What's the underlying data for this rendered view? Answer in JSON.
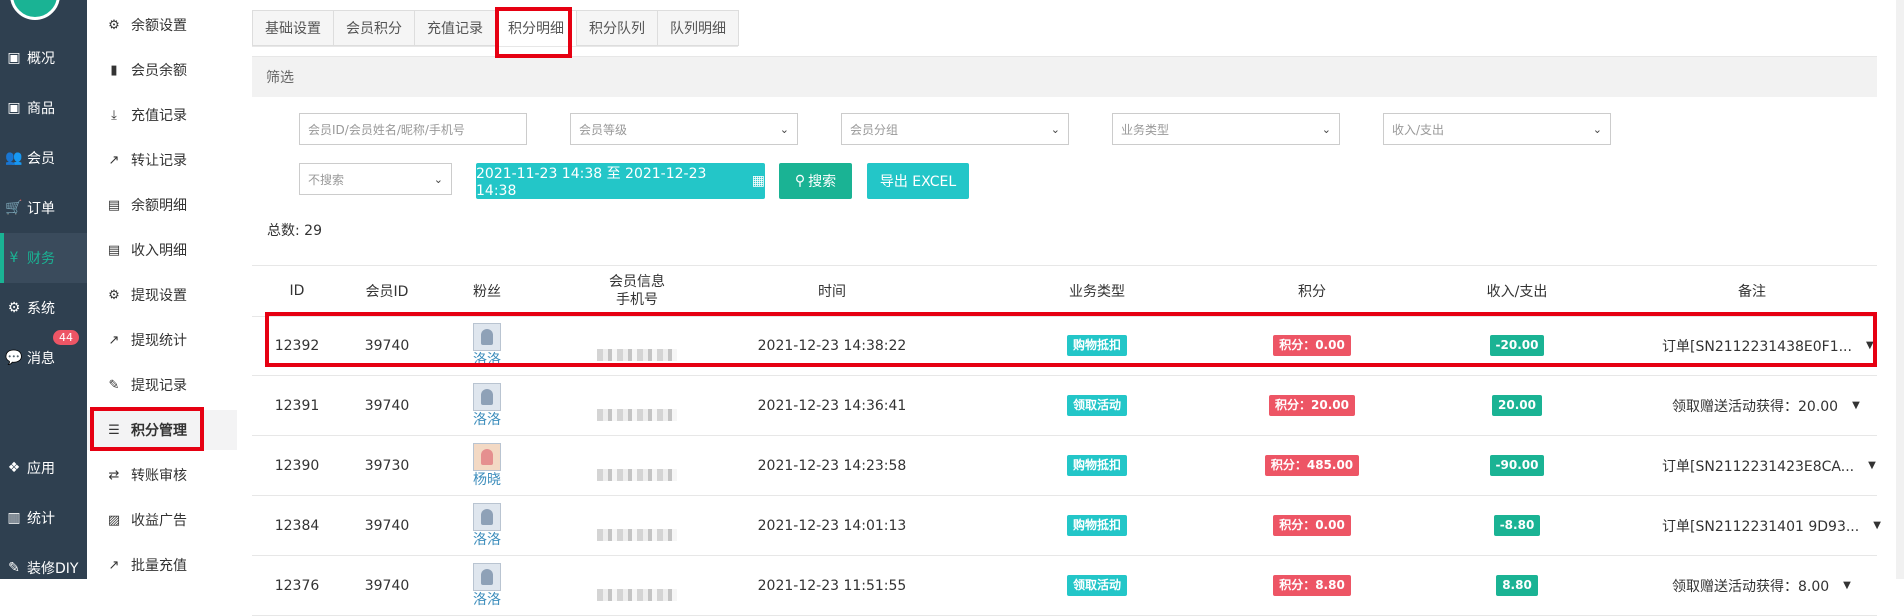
{
  "nav": {
    "items": [
      {
        "label": "概况",
        "icon": "dashboard-icon",
        "glyph": "▣"
      },
      {
        "label": "商品",
        "icon": "goods-icon",
        "glyph": "▣"
      },
      {
        "label": "会员",
        "icon": "users-icon",
        "glyph": "👥"
      },
      {
        "label": "订单",
        "icon": "cart-icon",
        "glyph": "🛒"
      },
      {
        "label": "财务",
        "icon": "yen-icon",
        "glyph": "¥"
      },
      {
        "label": "系统",
        "icon": "gears-icon",
        "glyph": "⚙"
      },
      {
        "label": "消息",
        "icon": "chat-icon",
        "glyph": "💬"
      },
      {
        "label": "应用",
        "icon": "apps-icon",
        "glyph": "❖"
      },
      {
        "label": "统计",
        "icon": "bar-chart-icon",
        "glyph": "▥"
      },
      {
        "label": "装修DIY",
        "icon": "brush-icon",
        "glyph": "✎"
      }
    ],
    "badge": "44"
  },
  "subnav": {
    "items": [
      {
        "label": "余额设置",
        "glyph": "⚙"
      },
      {
        "label": "会员余额",
        "glyph": "▮"
      },
      {
        "label": "充值记录",
        "glyph": "⤓"
      },
      {
        "label": "转让记录",
        "glyph": "↗"
      },
      {
        "label": "余额明细",
        "glyph": "▤"
      },
      {
        "label": "收入明细",
        "glyph": "▤"
      },
      {
        "label": "提现设置",
        "glyph": "⚙"
      },
      {
        "label": "提现统计",
        "glyph": "↗"
      },
      {
        "label": "提现记录",
        "glyph": "✎"
      },
      {
        "label": "积分管理",
        "glyph": "☰"
      },
      {
        "label": "转账审核",
        "glyph": "⇄"
      },
      {
        "label": "收益广告",
        "glyph": "▨"
      },
      {
        "label": "批量充值",
        "glyph": "↗"
      }
    ]
  },
  "tabs": [
    "基础设置",
    "会员积分",
    "充值记录",
    "积分明细",
    "积分队列",
    "队列明细"
  ],
  "filter": {
    "title": "筛选",
    "keyword_placeholder": "会员ID/会员姓名/昵称/手机号",
    "level_placeholder": "会员等级",
    "group_placeholder": "会员分组",
    "biztype_placeholder": "业务类型",
    "inout_placeholder": "收入/支出",
    "nosearch": "不搜索",
    "daterange": "2021-11-23 14:38 至 2021-12-23 14:38",
    "search_btn": "搜索",
    "export_btn": "导出 EXCEL"
  },
  "total_label": "总数:",
  "total_value": "29",
  "table": {
    "headers": {
      "id": "ID",
      "member_id": "会员ID",
      "fans": "粉丝",
      "member_info": "会员信息",
      "phone": "手机号",
      "time": "时间",
      "biz_type": "业务类型",
      "points": "积分",
      "inout": "收入/支出",
      "note": "备注"
    },
    "rows": [
      {
        "id": "12392",
        "member_id": "39740",
        "fan": "洛洛",
        "time": "2021-12-23 14:38:22",
        "biz": "购物抵扣",
        "points": "积分：0.00",
        "inout": "-20.00",
        "note": "订单[SN2112231438E0F1..."
      },
      {
        "id": "12391",
        "member_id": "39740",
        "fan": "洛洛",
        "time": "2021-12-23 14:36:41",
        "biz": "领取活动",
        "points": "积分：20.00",
        "inout": "20.00",
        "note": "领取赠送活动获得：20.00"
      },
      {
        "id": "12390",
        "member_id": "39730",
        "fan": "杨晓",
        "time": "2021-12-23 14:23:58",
        "biz": "购物抵扣",
        "points": "积分：485.00",
        "inout": "-90.00",
        "note": "订单[SN2112231423E8CA..."
      },
      {
        "id": "12384",
        "member_id": "39740",
        "fan": "洛洛",
        "time": "2021-12-23 14:01:13",
        "biz": "购物抵扣",
        "points": "积分：0.00",
        "inout": "-8.80",
        "note": "订单[SN2112231401 9D93..."
      },
      {
        "id": "12376",
        "member_id": "39740",
        "fan": "洛洛",
        "time": "2021-12-23 11:51:55",
        "biz": "领取活动",
        "points": "积分：8.80",
        "inout": "8.80",
        "note": "领取赠送活动获得：8.00"
      }
    ]
  }
}
